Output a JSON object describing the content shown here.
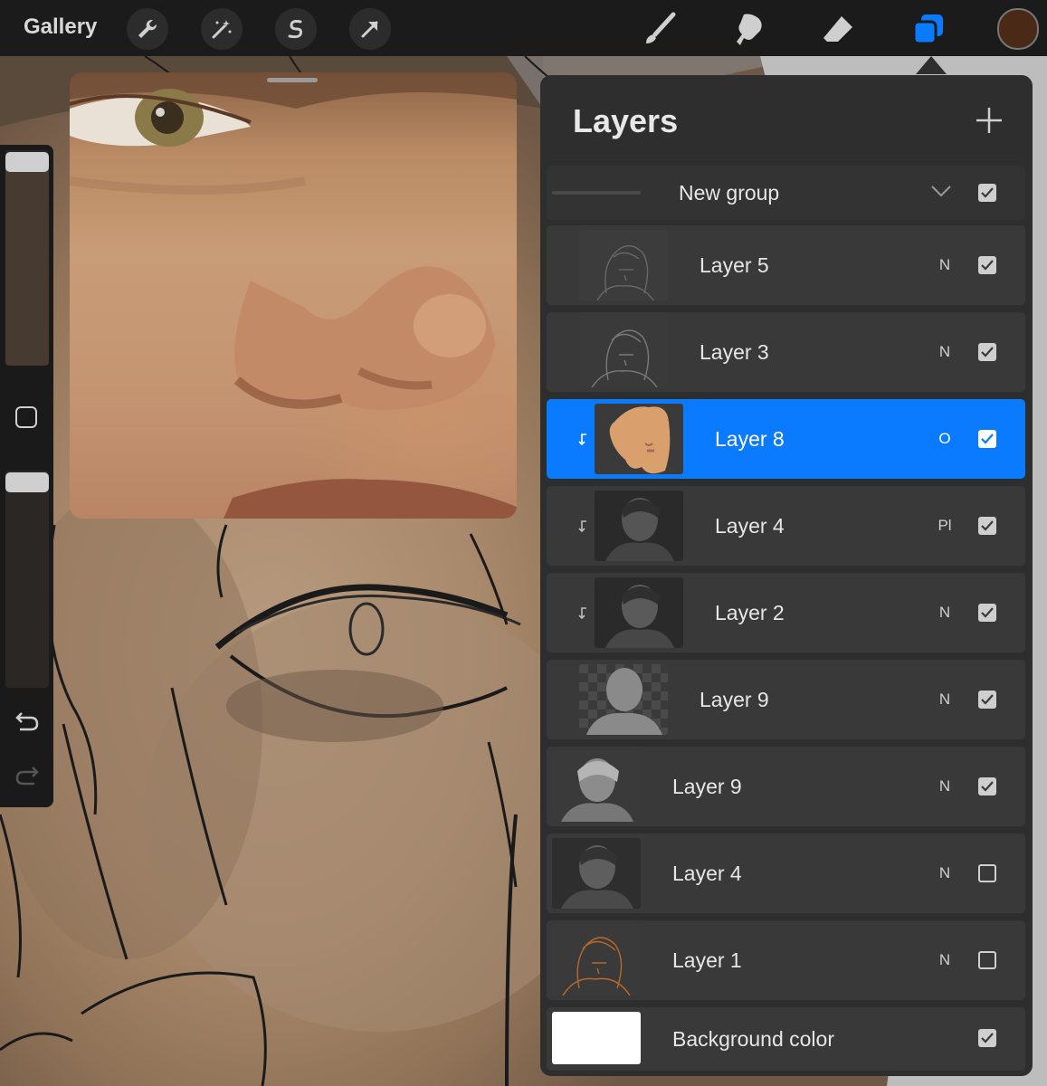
{
  "toolbar": {
    "gallery_label": "Gallery",
    "left_tools": [
      "wrench-icon",
      "magic-wand-icon",
      "selection-icon",
      "transform-arrow-icon"
    ],
    "right_tools": [
      "brush-icon",
      "smudge-icon",
      "eraser-icon",
      "layers-icon"
    ],
    "active_tool": "layers-icon",
    "accent_color": "#0a7aff",
    "current_color": "#4a2a16"
  },
  "sidebar": {
    "brush_size_icon": "slider",
    "modify_button_icon": "square-icon",
    "undo_icon": "undo-icon",
    "redo_icon": "redo-icon"
  },
  "layers_panel": {
    "title": "Layers",
    "add_icon": "plus-icon",
    "group": {
      "name": "New group",
      "expanded": true,
      "visible": true
    },
    "layers": [
      {
        "name": "Layer 5",
        "mode": "N",
        "visible": true,
        "clipped": false,
        "in_group": true,
        "selected": false,
        "thumb": "sketch"
      },
      {
        "name": "Layer 3",
        "mode": "N",
        "visible": true,
        "clipped": false,
        "in_group": true,
        "selected": false,
        "thumb": "sketch"
      },
      {
        "name": "Layer 8",
        "mode": "O",
        "visible": true,
        "clipped": true,
        "in_group": true,
        "selected": true,
        "thumb": "skin"
      },
      {
        "name": "Layer 4",
        "mode": "Pl",
        "visible": true,
        "clipped": true,
        "in_group": true,
        "selected": false,
        "thumb": "portrait"
      },
      {
        "name": "Layer 2",
        "mode": "N",
        "visible": true,
        "clipped": true,
        "in_group": true,
        "selected": false,
        "thumb": "portrait"
      },
      {
        "name": "Layer 9",
        "mode": "N",
        "visible": true,
        "clipped": false,
        "in_group": true,
        "selected": false,
        "thumb": "silhouette"
      },
      {
        "name": "Layer 9",
        "mode": "N",
        "visible": true,
        "clipped": false,
        "in_group": false,
        "selected": false,
        "thumb": "portrait-light"
      },
      {
        "name": "Layer 4",
        "mode": "N",
        "visible": false,
        "clipped": false,
        "in_group": false,
        "selected": false,
        "thumb": "portrait"
      },
      {
        "name": "Layer 1",
        "mode": "N",
        "visible": false,
        "clipped": false,
        "in_group": false,
        "selected": false,
        "thumb": "orange-sketch"
      }
    ],
    "background": {
      "name": "Background color",
      "visible": true,
      "color": "#ffffff"
    }
  }
}
